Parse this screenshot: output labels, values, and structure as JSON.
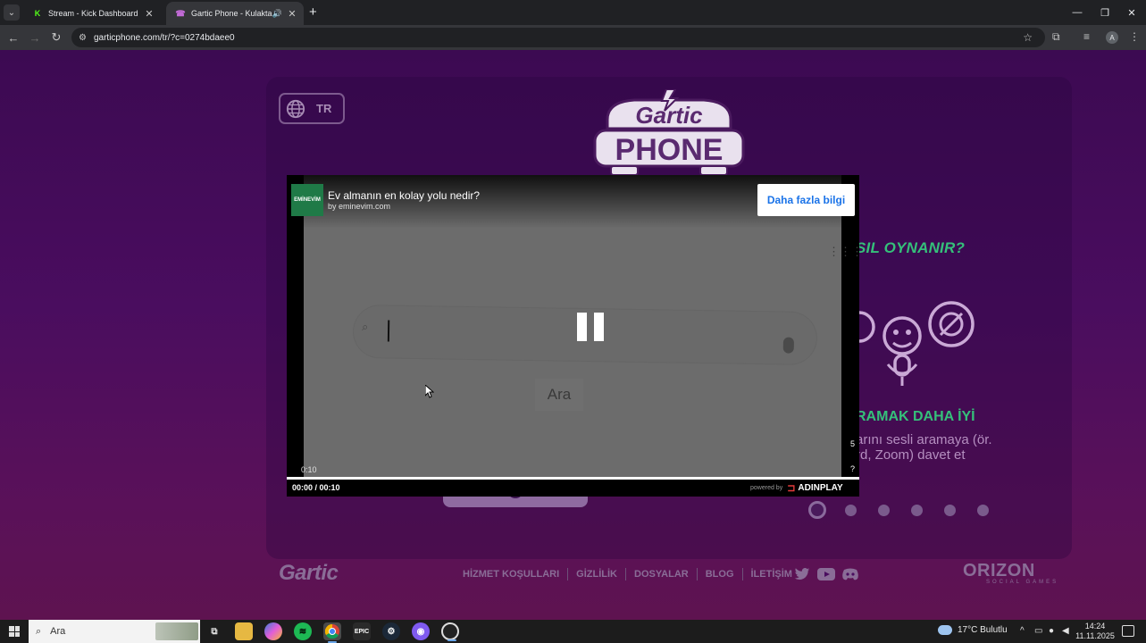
{
  "browser": {
    "tabs": [
      {
        "title": "Stream - Kick Dashboard",
        "favicon": "K",
        "color": "#53fc18",
        "active": false
      },
      {
        "title": "Gartic Phone - Kulaktan Kul",
        "favicon": "☎",
        "color": "#c36bd8",
        "active": true
      }
    ],
    "url": "garticphone.com/tr/?c=0274bdaee0"
  },
  "page": {
    "language_label": "TR",
    "logo": {
      "line1": "Gartic",
      "line2": "PHONE"
    },
    "how_to_play": "SIL OYNANIR?",
    "feature_title": "RAMAK DAHA İYİ",
    "feature_desc_line1": "arını sesli aramaya (ör.",
    "feature_desc_line2": "rd, Zoom) davet et",
    "carousel": {
      "count": 6,
      "active_index": 0
    },
    "footer": {
      "logo": "Gartic",
      "links": [
        "HİZMET KOŞULLARI",
        "GİZLİLİK",
        "DOSYALAR",
        "BLOG",
        "İLETİŞİM"
      ],
      "socials": [
        "twitter-icon",
        "youtube-icon",
        "discord-icon"
      ],
      "brand": "ORIZON",
      "brand_sub": "SOCIAL GAMES"
    }
  },
  "ad": {
    "brand_badge": "EMİNEVİM",
    "title": "Ev almanın en kolay yolu nedir?",
    "by": "by eminevim.com",
    "cta": "Daha fazla bilgi",
    "search_button": "Ara",
    "elapsed_small": "0:10",
    "time": "00:00 / 00:10",
    "skip_count": "5",
    "powered_by": "powered by",
    "network": "ADINPLAY",
    "progress": 1.0
  },
  "taskbar": {
    "search_placeholder": "Ara",
    "weather": "17°C  Bulutlu",
    "time": "14:24",
    "date": "11.11.2025"
  }
}
